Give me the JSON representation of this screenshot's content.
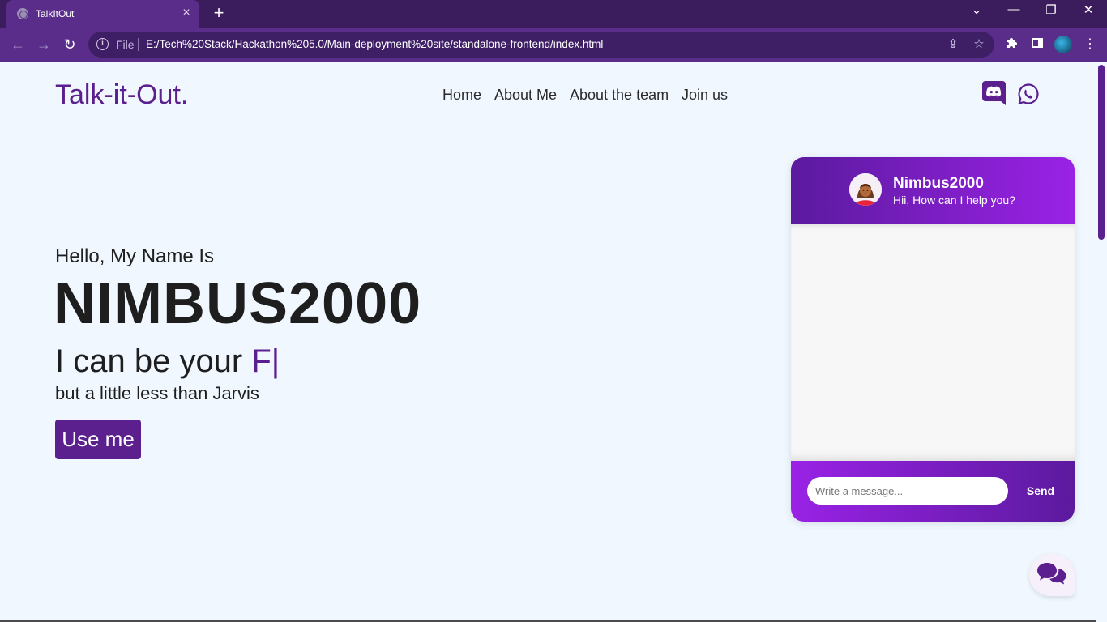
{
  "browser": {
    "tab_title": "TalkItOut",
    "tab_close": "×",
    "new_tab": "+",
    "file_label": "File",
    "url": "E:/Tech%20Stack/Hackathon%205.0/Main-deployment%20site/standalone-frontend/index.html",
    "back_icon": "←",
    "forward_icon": "→",
    "reload_icon": "↻",
    "share_icon": "⇪",
    "star_icon": "☆",
    "menu_icon": "⋮",
    "window_controls": {
      "tab_search": "⌄",
      "minimize": "—",
      "restore": "❐",
      "close": "✕"
    }
  },
  "header": {
    "logo": "Talk-it-Out.",
    "nav": [
      "Home",
      "About Me",
      "About the team",
      "Join us"
    ]
  },
  "hero": {
    "greeting": "Hello, My Name Is",
    "name": "NIMBUS2000",
    "tagline_prefix": "I can be your ",
    "tagline_typed": "F|",
    "subtitle": "but a little less than Jarvis",
    "cta": "Use me"
  },
  "chat": {
    "bot_name": "Nimbus2000",
    "bot_greeting": "Hii, How can I help you?",
    "input_placeholder": "Write a message...",
    "send_label": "Send"
  },
  "colors": {
    "brand": "#5b1f8e",
    "chat_gradient_start": "#5b1a9e",
    "chat_gradient_end": "#9a22e6",
    "page_bg": "#f0f7ff"
  }
}
